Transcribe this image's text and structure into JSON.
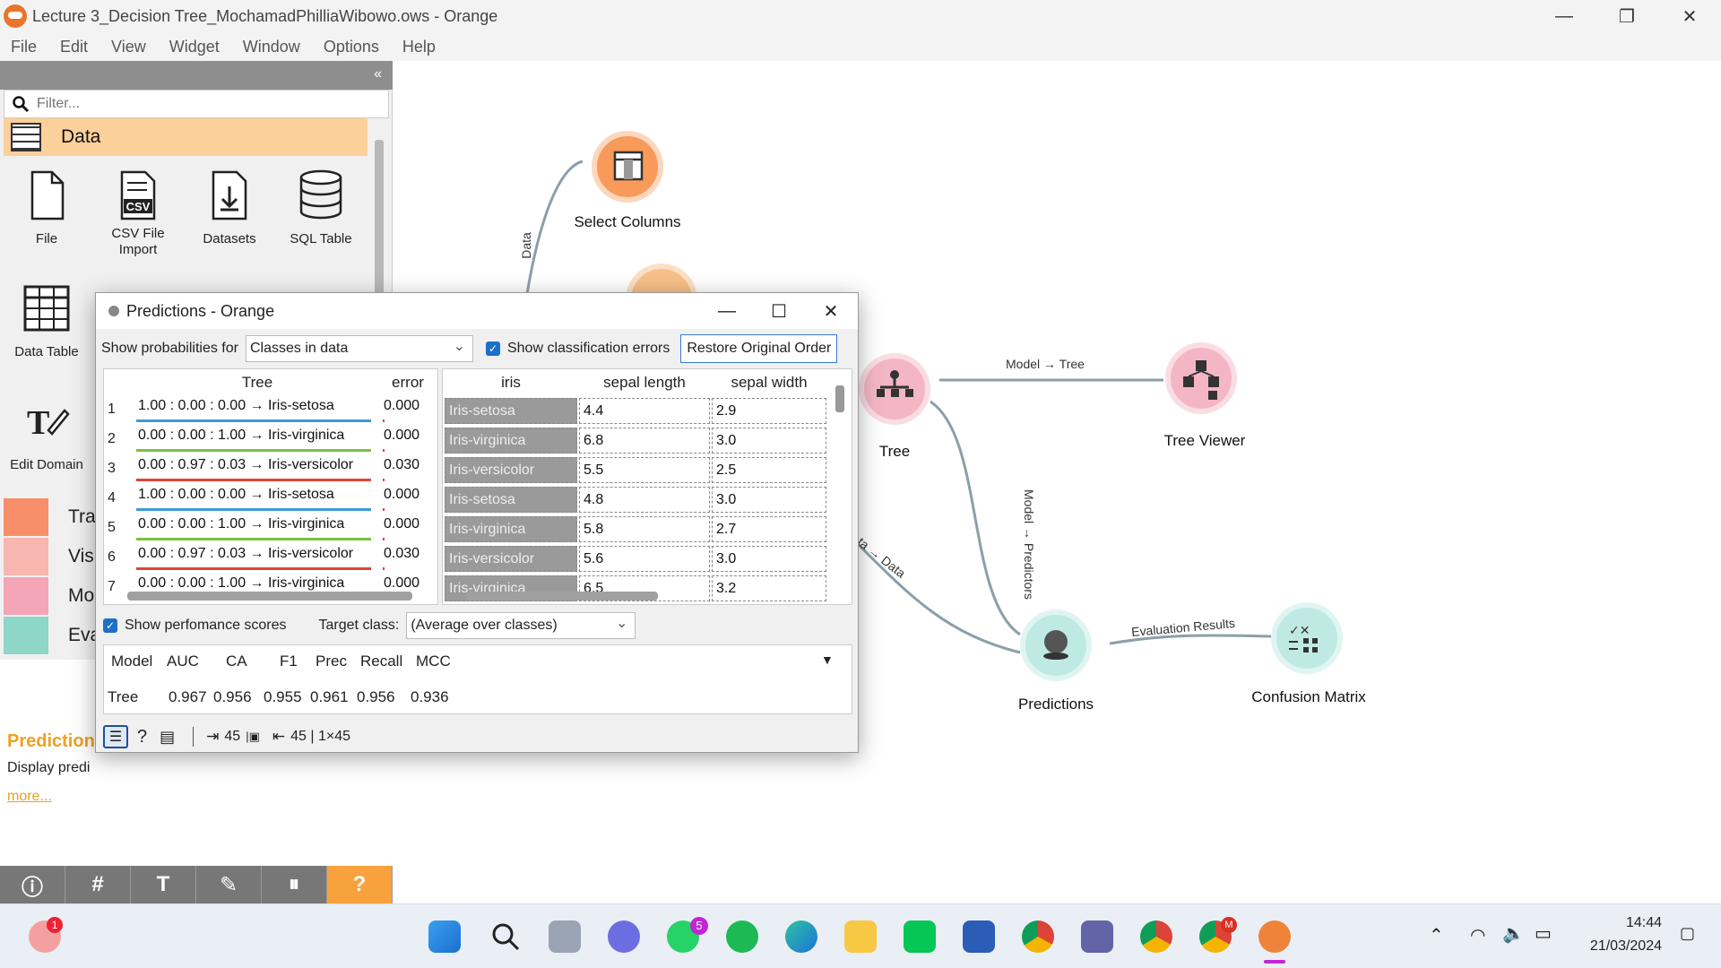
{
  "window": {
    "title": "Lecture 3_Decision Tree_MochamadPhilliaWibowo.ows - Orange",
    "min": "—",
    "max": "❐",
    "close": "✕"
  },
  "menu": [
    "File",
    "Edit",
    "View",
    "Widget",
    "Window",
    "Options",
    "Help"
  ],
  "toolbox": {
    "collapse": "«",
    "filter_placeholder": "Filter...",
    "category": "Data",
    "widgets": [
      {
        "label": "File"
      },
      {
        "label": "CSV File Import"
      },
      {
        "label": "Datasets"
      },
      {
        "label": "SQL Table"
      },
      {
        "label": "Data Table"
      },
      {
        "label": "Edit Domain"
      }
    ],
    "categories": [
      {
        "label": "Tra",
        "color": "#f7906a"
      },
      {
        "label": "Visu",
        "color": "#f7b6b0"
      },
      {
        "label": "Mod",
        "color": "#f4a6b8"
      },
      {
        "label": "Eva",
        "color": "#8dd6c8"
      }
    ],
    "description": {
      "title": "Prediction",
      "text": "Display predi",
      "more": "more..."
    },
    "bottom_tools": [
      "ⓘ",
      "#",
      "T",
      "✎",
      "⏸",
      "?"
    ]
  },
  "canvas": {
    "nodes": [
      {
        "label": "Select Columns",
        "color": "#f79a5a"
      },
      {
        "label": "Tree",
        "color": "#f4b6c4"
      },
      {
        "label": "Tree Viewer",
        "color": "#f4b6c4"
      },
      {
        "label": "Predictions",
        "color": "#bfeae4"
      },
      {
        "label": "Confusion Matrix",
        "color": "#bfeae4"
      }
    ],
    "links": {
      "data": "Data",
      "model_tree": "Model → Tree",
      "model_predictors": "Model → Predictors",
      "data_data": "ta → Data",
      "evaluation": "Evaluation Results"
    }
  },
  "dialog": {
    "title": "Predictions - Orange",
    "show_prob_label": "Show probabilities for",
    "show_prob_value": "Classes in data",
    "show_errors_label": "Show classification errors",
    "restore_button": "Restore Original Order",
    "left_headers": {
      "tree": "Tree",
      "error": "error"
    },
    "right_headers": {
      "iris": "iris",
      "sl": "sepal length",
      "sw": "sepal width"
    },
    "rows": [
      {
        "n": "1",
        "pred": "1.00 : 0.00 : 0.00 → Iris-setosa",
        "err": "0.000",
        "iris": "Iris-setosa",
        "sl": "4.4",
        "sw": "2.9",
        "color": "#3a9ad9"
      },
      {
        "n": "2",
        "pred": "0.00 : 0.00 : 1.00 → Iris-virginica",
        "err": "0.000",
        "iris": "Iris-virginica",
        "sl": "6.8",
        "sw": "3.0",
        "color": "#7bc043"
      },
      {
        "n": "3",
        "pred": "0.00 : 0.97 : 0.03 → Iris-versicolor",
        "err": "0.030",
        "iris": "Iris-versicolor",
        "sl": "5.5",
        "sw": "2.5",
        "color": "#d9453a"
      },
      {
        "n": "4",
        "pred": "1.00 : 0.00 : 0.00 → Iris-setosa",
        "err": "0.000",
        "iris": "Iris-setosa",
        "sl": "4.8",
        "sw": "3.0",
        "color": "#3a9ad9"
      },
      {
        "n": "5",
        "pred": "0.00 : 0.00 : 1.00 → Iris-virginica",
        "err": "0.000",
        "iris": "Iris-virginica",
        "sl": "5.8",
        "sw": "2.7",
        "color": "#7bc043"
      },
      {
        "n": "6",
        "pred": "0.00 : 0.97 : 0.03 → Iris-versicolor",
        "err": "0.030",
        "iris": "Iris-versicolor",
        "sl": "5.6",
        "sw": "3.0",
        "color": "#d9453a"
      },
      {
        "n": "7",
        "pred": "0.00 : 0.00 : 1.00 → Iris-virginica",
        "err": "0.000",
        "iris": "Iris-virginica",
        "sl": "6.5",
        "sw": "3.2",
        "color": "#7bc043"
      }
    ],
    "show_perf_label": "Show perfomance scores",
    "target_label": "Target class:",
    "target_value": "(Average over classes)",
    "perf_headers": [
      "Model",
      "AUC",
      "CA",
      "F1",
      "Prec",
      "Recall",
      "MCC"
    ],
    "perf_values": [
      "Tree",
      "0.967",
      "0.956",
      "0.955",
      "0.961",
      "0.956",
      "0.936"
    ],
    "status_in": "45",
    "status_out": "45 | 1×45"
  },
  "taskbar": {
    "time": "14:44",
    "date": "21/03/2024",
    "badge_whatsapp": "5",
    "badge_left": "1",
    "chrome_badge": "M"
  }
}
